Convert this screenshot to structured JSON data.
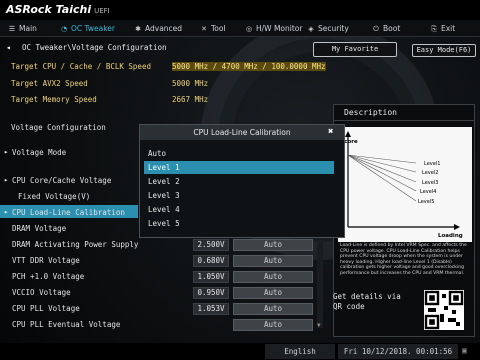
{
  "header": {
    "brand": "ASRock Taichi",
    "mode": "UEFI"
  },
  "tabs": [
    {
      "label": "Main",
      "icon": "list-icon"
    },
    {
      "label": "OC Tweaker",
      "icon": "gauge-icon"
    },
    {
      "label": "Advanced",
      "icon": "star-icon"
    },
    {
      "label": "Tool",
      "icon": "wrench-icon"
    },
    {
      "label": "H/W Monitor",
      "icon": "monitor-icon"
    },
    {
      "label": "Security",
      "icon": "shield-icon"
    },
    {
      "label": "Boot",
      "icon": "power-icon"
    },
    {
      "label": "Exit",
      "icon": "exit-icon"
    }
  ],
  "breadcrumb": {
    "back": "◂",
    "path": "OC Tweaker\\Voltage Configuration"
  },
  "buttons": {
    "favorite": "My Favorite",
    "easy_mode": "Easy Mode(F6)"
  },
  "targets": [
    {
      "label": "Target CPU / Cache / BCLK Speed",
      "value": "5000 MHz / 4700 MHz / 100.0000 MHz"
    },
    {
      "label": "Target AVX2 Speed",
      "value": "5000 MHz"
    },
    {
      "label": "Target Memory Speed",
      "value": "2667 MHz"
    }
  ],
  "section_title": "Voltage Configuration",
  "settings": [
    {
      "label": "Voltage Mode",
      "value": "",
      "auto": ""
    },
    {
      "label": "CPU Core/Cache Voltage",
      "value": "",
      "auto": ""
    },
    {
      "label": " Fixed Voltage(V)",
      "value": "",
      "auto": ""
    },
    {
      "label": "CPU Load-Line Calibration",
      "value": "",
      "auto": ""
    },
    {
      "label": "DRAM Voltage",
      "value": "",
      "auto": ""
    },
    {
      "label": "DRAM Activating Power Supply",
      "value": "2.500V",
      "auto": "Auto"
    },
    {
      "label": "VTT DDR Voltage",
      "value": "0.680V",
      "auto": "Auto"
    },
    {
      "label": "PCH +1.0 Voltage",
      "value": "1.050V",
      "auto": "Auto"
    },
    {
      "label": "VCCIO Voltage",
      "value": "0.950V",
      "auto": "Auto"
    },
    {
      "label": "CPU PLL Voltage",
      "value": "1.053V",
      "auto": "Auto"
    },
    {
      "label": "CPU PLL Eventual Voltage",
      "value": "",
      "auto": "Auto"
    }
  ],
  "modal": {
    "title": "CPU Load-Line Calibration",
    "options": [
      "Auto",
      "Level 1",
      "Level 2",
      "Level 3",
      "Level 4",
      "Level 5"
    ],
    "selected": "Level 1"
  },
  "description": {
    "title": "Description",
    "chart": {
      "ylabel": "Vcore",
      "xlabel": "Loading",
      "levels": [
        "Level1",
        "Level2",
        "Level3",
        "Level4",
        "Level5"
      ]
    },
    "text": "Load-Line is defined by Intel VRM Spec. and affects the CPU power voltage. CPU Load-Line Calibration helps prevent CPU voltage droop when the system is under heavy loading. Higher load-line Level 1 (Disable) calibration gets higher voltage and good overclocking performance but increases the CPU and VRM thermal.",
    "qr_text": "Get details via QR code"
  },
  "status": {
    "language": "English",
    "datetime": "Fri 10/12/2018. 00:01:56"
  }
}
